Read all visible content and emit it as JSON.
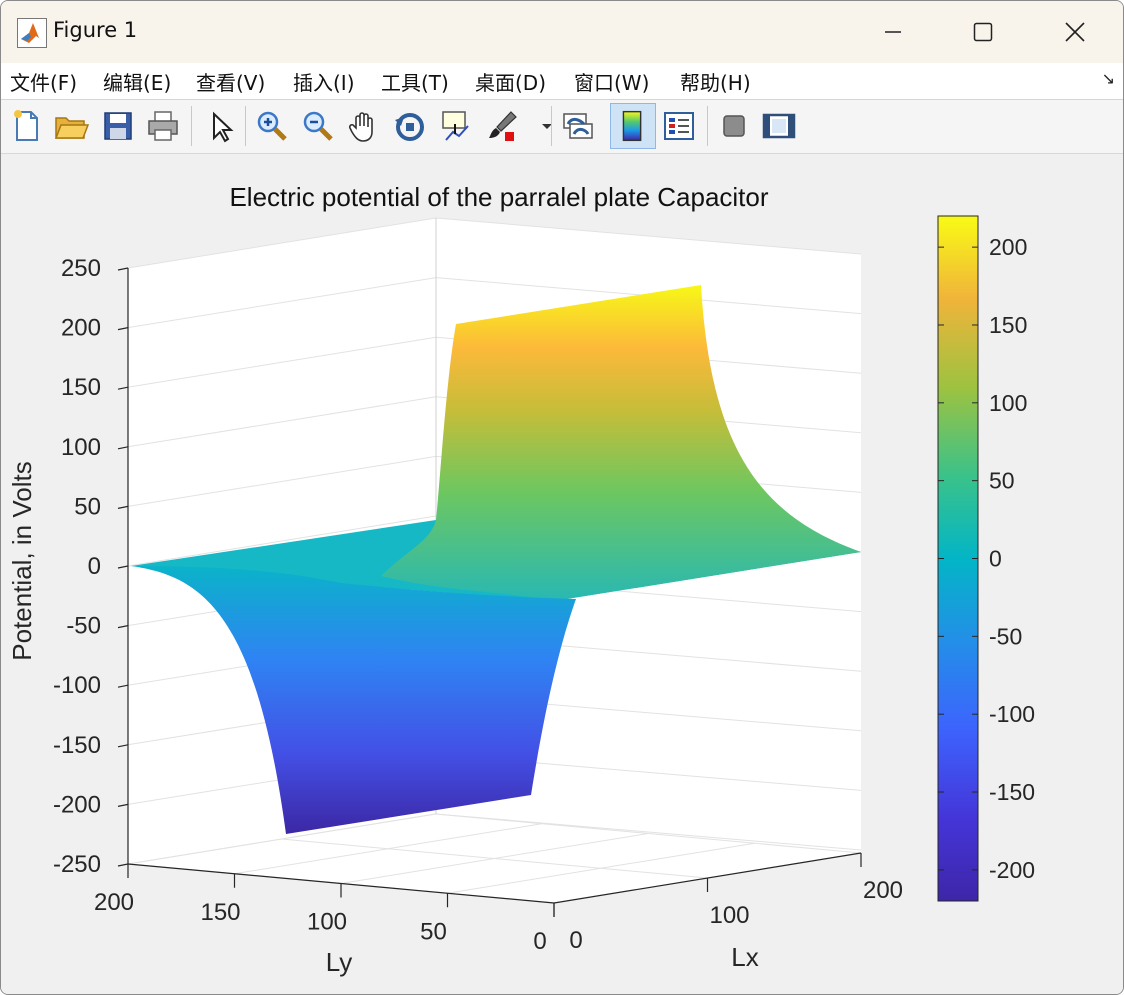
{
  "window": {
    "title": "Figure 1"
  },
  "menu": {
    "items": [
      "文件(F)",
      "编辑(E)",
      "查看(V)",
      "插入(I)",
      "工具(T)",
      "桌面(D)",
      "窗口(W)",
      "帮助(H)"
    ],
    "corner_icon": "↘"
  },
  "toolbar": {
    "icons": [
      "new-figure-icon",
      "open-file-icon",
      "save-icon",
      "print-icon",
      "select-arrow-icon",
      "zoom-in-icon",
      "zoom-out-icon",
      "pan-hand-icon",
      "rotate-3d-icon",
      "data-cursor-icon",
      "brush-icon",
      "link-plot-icon",
      "colorbar-icon",
      "legend-icon",
      "hide-plot-tools-icon",
      "show-plot-tools-icon"
    ]
  },
  "chart_data": {
    "type": "surface",
    "title": "Electric potential of the parralel plate Capacitor",
    "xlabel": "Lx",
    "ylabel": "Ly",
    "zlabel": "Potential, in Volts",
    "xlim": [
      0,
      200
    ],
    "ylim": [
      0,
      200
    ],
    "zlim": [
      -250,
      250
    ],
    "x_ticks": [
      "0",
      "100",
      "200"
    ],
    "y_ticks": [
      "0",
      "50",
      "100",
      "150",
      "200"
    ],
    "z_ticks": [
      "250",
      "200",
      "150",
      "100",
      "50",
      "0",
      "-50",
      "-100",
      "-150",
      "-200",
      "-250"
    ],
    "plates": [
      {
        "potential": 220,
        "x_position": 140,
        "y_extent": [
          0,
          200
        ]
      },
      {
        "potential": -220,
        "x_position": 60,
        "y_extent": [
          0,
          200
        ]
      }
    ],
    "colormap": "parula",
    "colorbar": {
      "ticks": [
        "200",
        "150",
        "100",
        "50",
        "0",
        "-50",
        "-100",
        "-150",
        "-200"
      ],
      "range": [
        -220,
        220
      ]
    },
    "grid": true
  }
}
